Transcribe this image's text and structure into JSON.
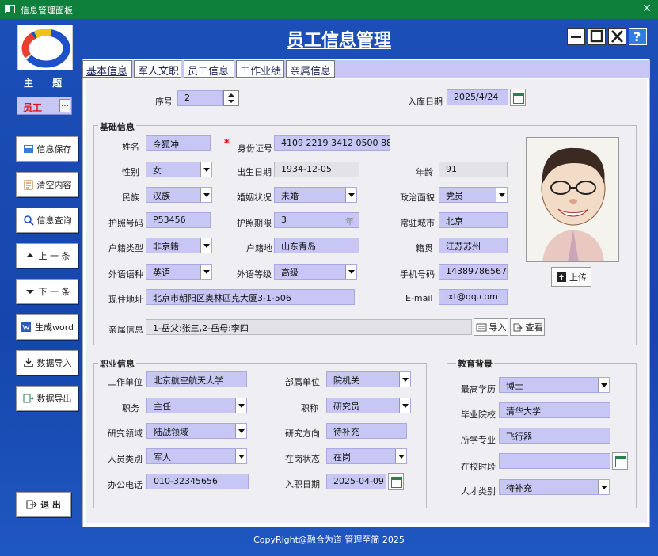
{
  "window": {
    "title": "信息管理面板",
    "close": "✕"
  },
  "app_title": "员工信息管理",
  "sidebar": {
    "theme_label": "主 题",
    "theme_value": "员工",
    "theme_btn": "...",
    "buttons": [
      {
        "label": "信息保存",
        "icon": "save-icon"
      },
      {
        "label": "清空内容",
        "icon": "clear-icon"
      },
      {
        "label": "信息查询",
        "icon": "search-icon"
      },
      {
        "label": "上 一 条",
        "icon": "arrow-up-icon"
      },
      {
        "label": "下 一 条",
        "icon": "arrow-down-icon"
      },
      {
        "label": "生成word",
        "icon": "word-icon"
      },
      {
        "label": "数据导入",
        "icon": "import-icon"
      },
      {
        "label": "数据导出",
        "icon": "export-icon"
      }
    ],
    "exit": "退 出"
  },
  "tabs": [
    "基本信息",
    "军人文职",
    "员工信息",
    "工作业绩",
    "亲属信息"
  ],
  "top": {
    "seq_label": "序号",
    "seq_value": "2",
    "date_label": "入库日期",
    "date_value": "2025/4/24"
  },
  "basic": {
    "title": "基础信息",
    "name_label": "姓名",
    "name": "令狐冲",
    "id_label": "身份证号",
    "id_value": "4109 2219 3412 0500 88",
    "gender_label": "性别",
    "gender": "女",
    "birth_label": "出生日期",
    "birth": "1934-12-05",
    "age_label": "年龄",
    "age": "91",
    "ethnic_label": "民族",
    "ethnic": "汉族",
    "marital_label": "婚姻状况",
    "marital": "未婚",
    "political_label": "政治面貌",
    "political": "党员",
    "passport_label": "护照号码",
    "passport": "P53456",
    "passport_term_label": "护照期限",
    "passport_term": "3",
    "passport_unit": "年",
    "city_label": "常驻城市",
    "city": "北京",
    "hukou_type_label": "户籍类型",
    "hukou_type": "非京籍",
    "hukou_place_label": "户籍地",
    "hukou_place": "山东青岛",
    "native_label": "籍贯",
    "native": "江苏苏州",
    "lang_label": "外语语种",
    "lang": "英语",
    "lang_level_label": "外语等级",
    "lang_level": "高级",
    "phone_label": "手机号码",
    "phone": "14389786567",
    "address_label": "现住地址",
    "address": "北京市朝阳区奥林匹克大厦3-1-506",
    "email_label": "E-mail",
    "email": "lxt@qq.com",
    "relatives_label": "亲属信息",
    "relatives": "1-岳父:张三,2-岳母:李四",
    "import_btn": "导入",
    "view_btn": "查看",
    "upload_btn": "上传"
  },
  "career": {
    "title": "职业信息",
    "unit_label": "工作单位",
    "unit": "北京航空航天大学",
    "dept_label": "部属单位",
    "dept": "院机关",
    "post_label": "职务",
    "post": "主任",
    "rank_label": "职称",
    "rank": "研究员",
    "field_label": "研究领域",
    "field": "陆战领域",
    "direction_label": "研究方向",
    "direction": "待补充",
    "category_label": "人员类别",
    "category": "军人",
    "status_label": "在岗状态",
    "status": "在岗",
    "office_phone_label": "办公电话",
    "office_phone": "010-32345656",
    "join_label": "入职日期",
    "join": "2025-04-09"
  },
  "edu": {
    "title": "教育背景",
    "degree_label": "最高学历",
    "degree": "博士",
    "school_label": "毕业院校",
    "school": "清华大学",
    "major_label": "所学专业",
    "major": "飞行器",
    "period_label": "在校时段",
    "period": "",
    "talent_label": "人才类别",
    "talent": "待补充"
  },
  "footer": "CopyRight@融合为道 管理至简 2025"
}
